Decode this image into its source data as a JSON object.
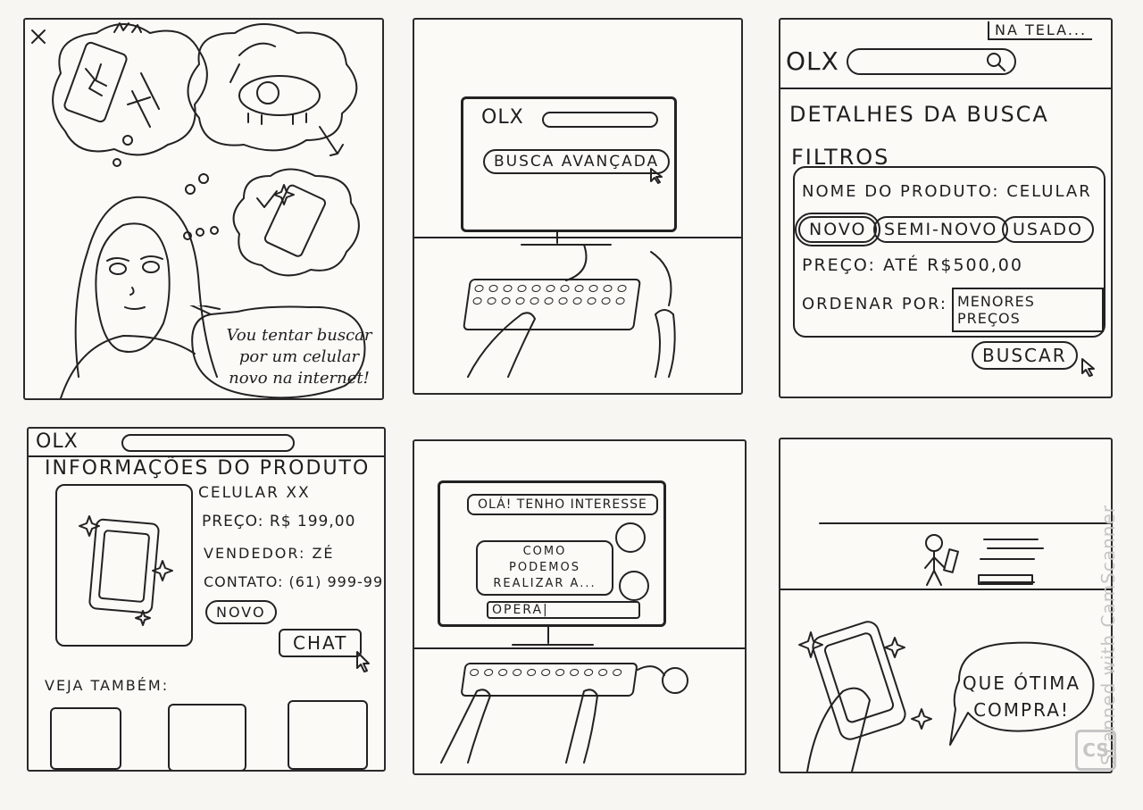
{
  "panel1": {
    "speech": "Vou tentar buscar por um celular novo na internet!",
    "money_symbol": "$"
  },
  "panel2": {
    "logo": "OLX",
    "button": "BUSCA AVANÇADA"
  },
  "panel3": {
    "caption": "NA TELA...",
    "logo": "OLX",
    "heading": "DETALHES DA BUSCA",
    "filters_label": "FILTROS",
    "product_name": "NOME DO PRODUTO: CELULAR",
    "conditions": [
      "NOVO",
      "SEMI-NOVO",
      "USADO"
    ],
    "price": "PREÇO: ATÉ R$500,00",
    "sort_label": "ORDENAR POR:",
    "sort_value": "MENORES PREÇOS",
    "search_button": "BUSCAR"
  },
  "panel4": {
    "logo": "OLX",
    "heading": "INFORMAÇÕES DO PRODUTO",
    "product": "CELULAR XX",
    "price": "PREÇO: R$ 199,00",
    "seller": "VENDEDOR: ZÉ",
    "contact": "CONTATO: (61) 999-99",
    "condition": "NOVO",
    "chat_button": "CHAT",
    "see_also": "VEJA TAMBÉM:"
  },
  "panel5": {
    "messages": [
      "OLÁ! TENHO INTERESSE",
      "COMO PODEMOS REALIZAR A..."
    ],
    "input_value": "OPERA|"
  },
  "panel6": {
    "speech": "QUE ÓTIMA COMPRA!"
  },
  "watermark": {
    "text": "Scanned with CamScanner",
    "badge": "CS"
  }
}
